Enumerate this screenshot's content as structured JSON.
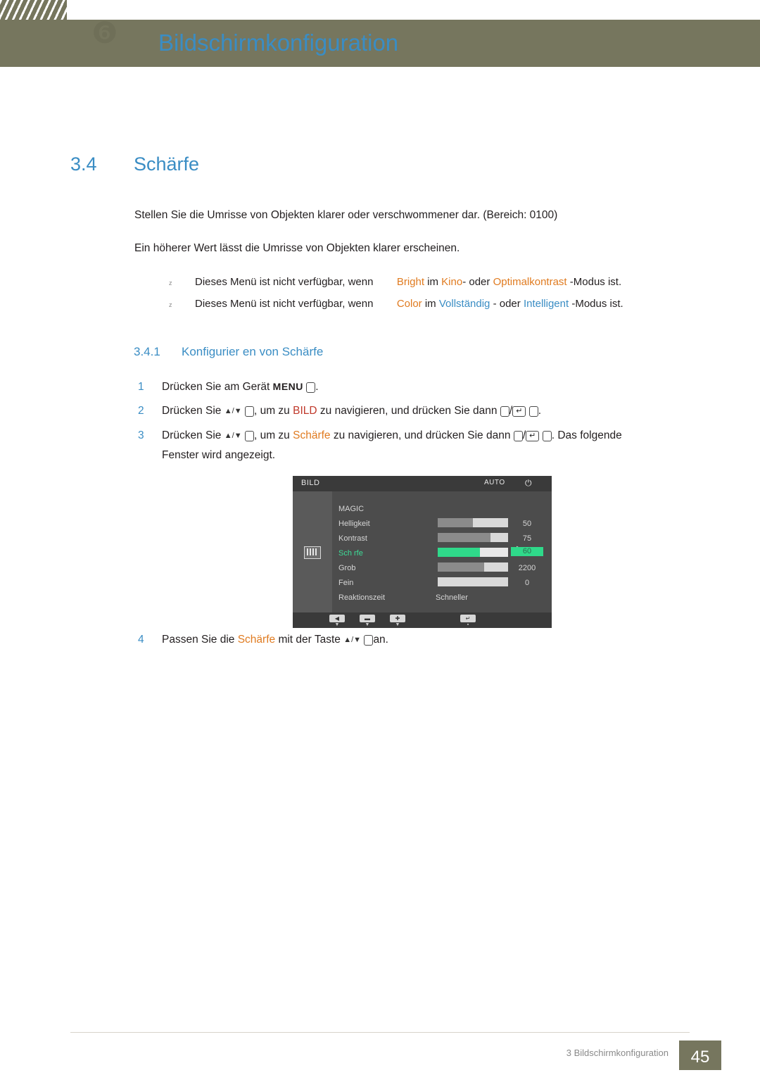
{
  "header": {
    "title": "Bildschirmkonfiguration"
  },
  "section": {
    "number": "3.4",
    "title": "Schärfe"
  },
  "intro": {
    "line1": "Stellen Sie die Umrisse von Objekten klarer oder verschwommener dar. (Bereich: 0100)",
    "line2": "Ein höherer Wert lässt die Umrisse von Objekten klarer erscheinen."
  },
  "notes": [
    {
      "prefix": "Dieses Menü ist nicht verfügbar, wenn",
      "term1": "Bright",
      "mid1": "im",
      "term2": "Kino",
      "mid2": "- oder",
      "term3": "Optimalkontrast",
      "suffix": "-Modus ist."
    },
    {
      "prefix": "Dieses Menü ist nicht verfügbar, wenn",
      "term1": "Color",
      "mid1": "im",
      "term2": "Vollständig",
      "mid2": "- oder",
      "term3": "Intelligent",
      "suffix": "-Modus ist."
    }
  ],
  "subsection": {
    "number": "3.4.1",
    "title": "Konfigurier en von Schärfe"
  },
  "steps": [
    {
      "num": "1",
      "a": "Drücken Sie am Gerät",
      "b": "MENU",
      "c": "."
    },
    {
      "num": "2",
      "a": "Drücken Sie",
      "keys": "▲/▼",
      "b": ", um zu",
      "target": "BILD",
      "c": "zu navigieren, und drücken Sie dann",
      "d": "/",
      "e": "."
    },
    {
      "num": "3",
      "a": "Drücken Sie",
      "keys": "▲/▼",
      "b": ", um zu",
      "target": "Schärfe",
      "c": "zu navigieren, und drücken Sie dann",
      "d": "/",
      "e": ". Das folgende",
      "line2": "Fenster wird angezeigt."
    },
    {
      "num": "4",
      "a": "Passen Sie die",
      "target": "Schärfe",
      "b": "mit der Taste",
      "keys": "▲/▼",
      "c": "an."
    }
  ],
  "osd": {
    "title": "BILD",
    "arrow_glyph": "▶",
    "rows": [
      {
        "label": "MAGIC",
        "value": "",
        "bar": null,
        "selected": false
      },
      {
        "label": "Helligkeit",
        "value": "50",
        "bar": 50,
        "selected": false
      },
      {
        "label": "Kontrast",
        "value": "75",
        "bar": 75,
        "selected": false
      },
      {
        "label": "Sch rfe",
        "value": "60",
        "bar": 60,
        "selected": true
      },
      {
        "label": "Grob",
        "value": "2200",
        "bar": 66,
        "selected": false
      },
      {
        "label": "Fein",
        "value": "0",
        "bar": 0,
        "selected": false
      },
      {
        "label": "Reaktionszeit",
        "value": "Schneller",
        "bar": null,
        "selected": false
      }
    ],
    "footer": {
      "btn1": "◀",
      "sub1": "▼",
      "btn2": "▬",
      "sub2": "▼",
      "btn3": "✚",
      "sub3": "▼",
      "btn4": "↵",
      "sub4": "▪",
      "auto": "AUTO",
      "power": "⏻"
    },
    "colors": {
      "selected": "#2fd98a",
      "bar_bg": "#d9d9d9",
      "bar_fill": "#8b8b8b"
    }
  },
  "footer": {
    "text": "3 Bildschirmkonfiguration",
    "page": "45"
  }
}
